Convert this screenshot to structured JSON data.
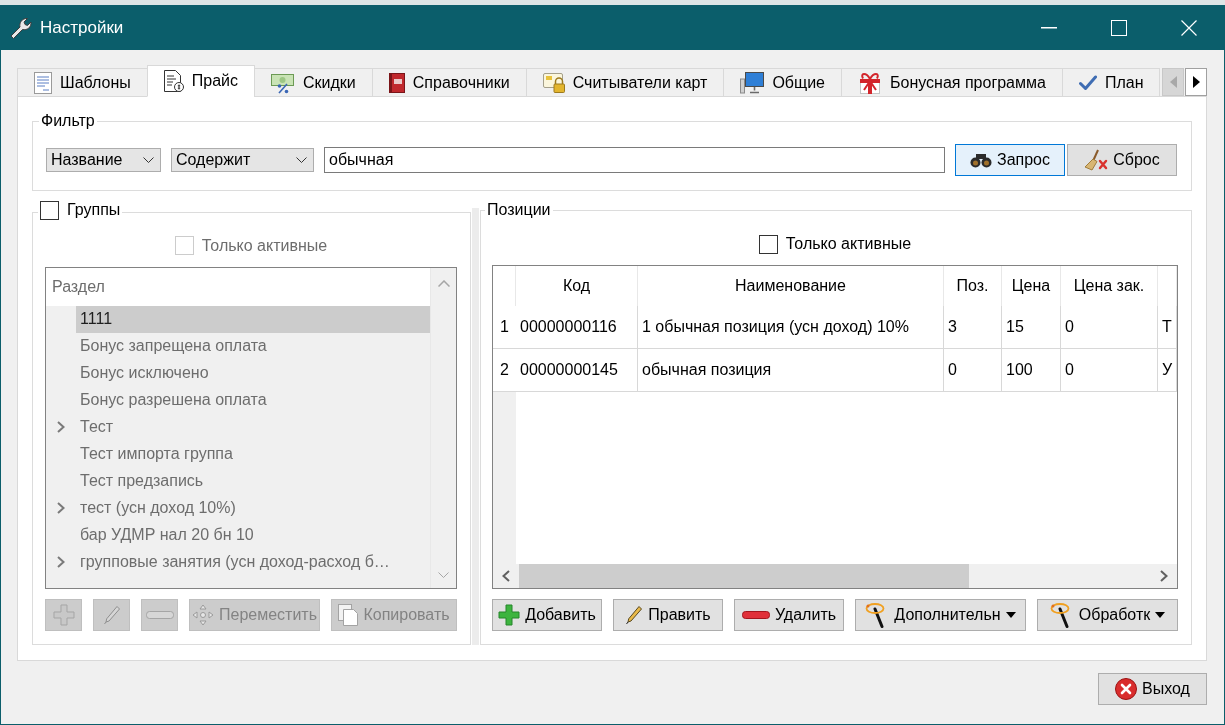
{
  "window": {
    "title": "Настройки"
  },
  "tabs": [
    {
      "label": "Шаблоны",
      "selected": false
    },
    {
      "label": "Прайс",
      "selected": true
    },
    {
      "label": "Скидки",
      "selected": false
    },
    {
      "label": "Справочники",
      "selected": false
    },
    {
      "label": "Считыватели карт",
      "selected": false
    },
    {
      "label": "Общие",
      "selected": false
    },
    {
      "label": "Бонусная программа",
      "selected": false
    },
    {
      "label": "План",
      "selected": false
    }
  ],
  "tab_scroller": {
    "back_disabled": true,
    "forward_disabled": false
  },
  "filter": {
    "title": "Фильтр",
    "field": "Название",
    "condition": "Содержит",
    "query": "обычная",
    "buttons": [
      {
        "kind": "search",
        "label": "Запрос",
        "focused": true
      },
      {
        "kind": "reset",
        "label": "Сброс",
        "focused": false
      }
    ]
  },
  "groups": {
    "title": "Группы",
    "checked": false,
    "active_only": {
      "label": "Только активные",
      "checked": false,
      "disabled": true
    },
    "tree": {
      "header": "Раздел",
      "disabled": true,
      "items": [
        {
          "label": "1111",
          "expandable": false,
          "selected": true
        },
        {
          "label": "Бонус запрещена оплата",
          "expandable": false,
          "selected": false
        },
        {
          "label": "Бонус исключено",
          "expandable": false,
          "selected": false
        },
        {
          "label": "Бонус разрешена оплата",
          "expandable": false,
          "selected": false
        },
        {
          "label": "Тест",
          "expandable": true,
          "selected": false
        },
        {
          "label": "Тест импорта группа",
          "expandable": false,
          "selected": false
        },
        {
          "label": "Тест предзапись",
          "expandable": false,
          "selected": false
        },
        {
          "label": "тест (усн доход 10%)",
          "expandable": true,
          "selected": false
        },
        {
          "label": "бар УДМР нал 20 бн 10",
          "expandable": false,
          "selected": false
        },
        {
          "label": "групповые занятия (усн доход-расход б…",
          "expandable": true,
          "selected": false
        }
      ]
    },
    "buttons": [
      {
        "kind": "add",
        "disabled": true
      },
      {
        "kind": "edit",
        "disabled": true
      },
      {
        "kind": "remove",
        "disabled": true
      },
      {
        "kind": "move",
        "label": "Переместить",
        "disabled": true
      },
      {
        "kind": "copy",
        "label": "Копировать",
        "disabled": true
      }
    ]
  },
  "positions": {
    "title": "Позиции",
    "active_only": {
      "label": "Только активные",
      "checked": false
    },
    "table": {
      "columns": [
        "Код",
        "Наименование",
        "Поз.",
        "Цена",
        "Цена зак."
      ],
      "rows": [
        {
          "number": "1",
          "cells": [
            "00000000116",
            "1 обычная позиция (усн доход) 10%",
            "3",
            "15",
            "0",
            "Т"
          ]
        },
        {
          "number": "2",
          "cells": [
            "00000000145",
            "обычная позиция",
            "0",
            "100",
            "0",
            "У"
          ]
        }
      ]
    },
    "buttons": [
      {
        "kind": "add",
        "label": "Добавить",
        "dropdown": false
      },
      {
        "kind": "edit",
        "label": "Править",
        "dropdown": false
      },
      {
        "kind": "remove",
        "label": "Удалить",
        "dropdown": false
      },
      {
        "kind": "tools",
        "label": "Дополнительн",
        "dropdown": true
      },
      {
        "kind": "tools",
        "label": "Обработк",
        "dropdown": true
      }
    ]
  },
  "exit_button": {
    "label": "Выход"
  }
}
